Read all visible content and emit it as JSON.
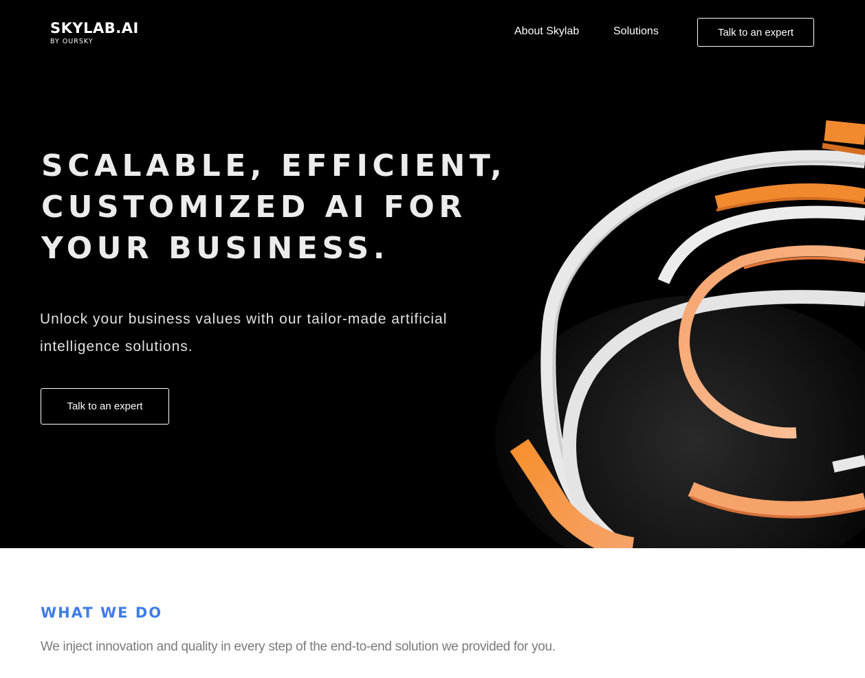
{
  "header": {
    "logo": {
      "name": "SKYLAB.AI",
      "tagline": "BY OURSKY"
    },
    "nav": [
      {
        "label": "About Skylab"
      },
      {
        "label": "Solutions"
      }
    ],
    "cta_label": "Talk to an expert"
  },
  "hero": {
    "title": "Scalable, efficient, customized AI for your business.",
    "subtitle": "Unlock your business values with our tailor-made artificial intelligence solutions.",
    "cta_label": "Talk to an expert",
    "art_icon": "spiral-rings-illustration"
  },
  "section": {
    "title": "What we do",
    "description": "We inject innovation and quality in every step of the end-to-end solution we provided for you."
  },
  "colors": {
    "hero_background": "#000000",
    "accent_blue": "#3f7de6",
    "accent_orange": "#f18a2e",
    "page_background": "#ffffff",
    "muted_text": "#7a7a7a"
  }
}
